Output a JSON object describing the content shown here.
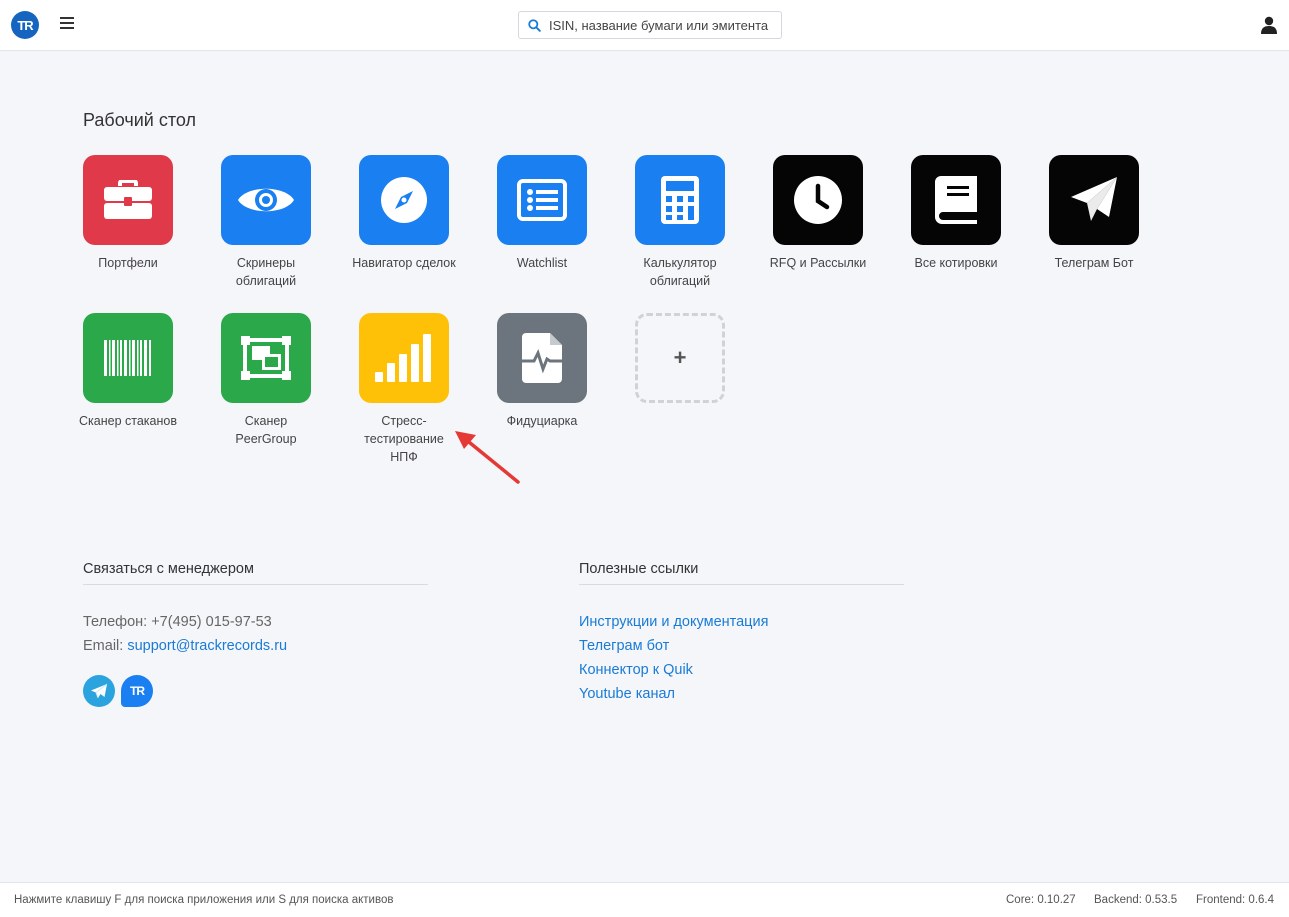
{
  "header": {
    "logo_text": "TR",
    "search": {
      "placeholder": "ISIN, название бумаги или эмитента",
      "value": ""
    }
  },
  "desktop": {
    "title": "Рабочий стол",
    "apps": [
      {
        "label": "Портфели",
        "color": "#e03a4a",
        "icon": "briefcase-icon"
      },
      {
        "label": "Скринеры облигаций",
        "color": "#1a7ff0",
        "icon": "eye-icon"
      },
      {
        "label": "Навигатор сделок",
        "color": "#1a7ff0",
        "icon": "compass-icon"
      },
      {
        "label": "Watchlist",
        "color": "#1a7ff0",
        "icon": "list-icon"
      },
      {
        "label": "Калькулятор облигаций",
        "color": "#1a7ff0",
        "icon": "calculator-icon"
      },
      {
        "label": "RFQ и Рассылки",
        "color": "#050505",
        "icon": "clock-icon"
      },
      {
        "label": "Все котировки",
        "color": "#050505",
        "icon": "book-icon"
      },
      {
        "label": "Телеграм Бот",
        "color": "#050505",
        "icon": "paper-plane-icon"
      },
      {
        "label": "Сканер стаканов",
        "color": "#2ba84a",
        "icon": "barcode-icon"
      },
      {
        "label": "Сканер PeerGroup",
        "color": "#2ba84a",
        "icon": "object-group-icon"
      },
      {
        "label": "Стресс-тестирование НПФ",
        "color": "#ffc107",
        "icon": "signal-bars-icon"
      },
      {
        "label": "Фидуциарка",
        "color": "#6c757d",
        "icon": "file-pulse-icon"
      }
    ],
    "add_label": "+"
  },
  "contacts": {
    "title": "Связаться с менеджером",
    "phone_label": "Телефон:",
    "phone": "+7(495) 015-97-53",
    "email_label": "Email:",
    "email": "support@trackrecords.ru",
    "chat_logo_text": "TR"
  },
  "links": {
    "title": "Полезные ссылки",
    "items": [
      "Инструкции и документация",
      "Телеграм бот",
      "Коннектор к Quik",
      "Youtube канал"
    ]
  },
  "statusbar": {
    "hint": "Нажмите клавишу F для поиска приложения или S для поиска активов",
    "core": "Core: 0.10.27",
    "backend": "Backend: 0.53.5",
    "frontend": "Frontend: 0.6.4"
  },
  "colors": {
    "accent": "#1a7bd6",
    "annotation_arrow": "#e53935"
  }
}
